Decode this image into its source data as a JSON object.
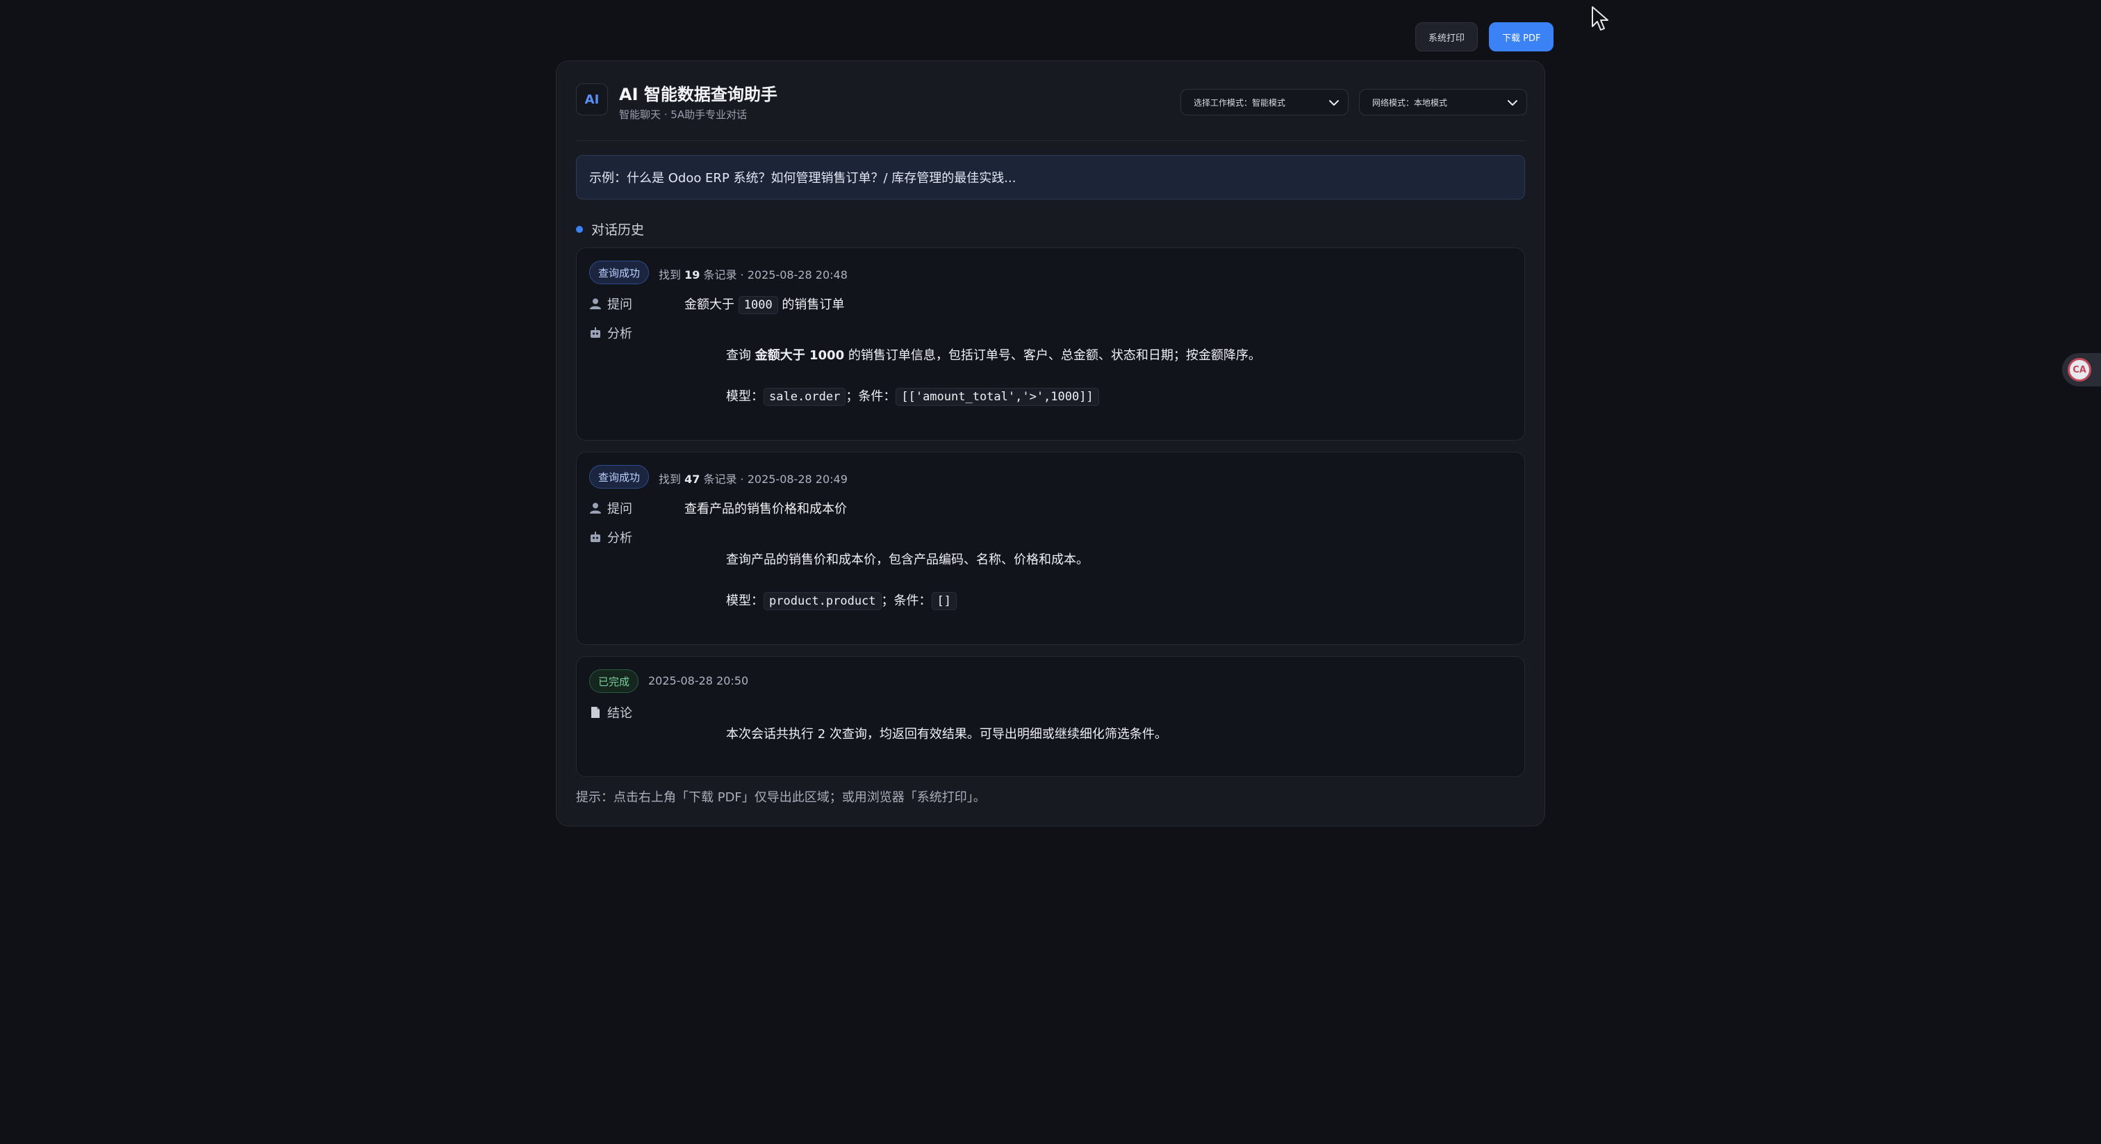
{
  "toolbar": {
    "print_label": "系统打印",
    "pdf_label": "下载 PDF"
  },
  "header": {
    "logo": "AI",
    "title": "AI 智能数据查询助手",
    "subtitle": "智能聊天 · 5A助手专业对话",
    "work_mode": "选择工作模式：智能模式",
    "network_mode": "网络模式：本地模式"
  },
  "example": "示例：什么是 Odoo ERP 系统？如何管理销售订单？/ 库存管理的最佳实践...",
  "history": {
    "title": "对话历史",
    "cards": [
      {
        "status": "查询成功",
        "meta_prefix": "找到 ",
        "count": "19",
        "meta_suffix": " 条记录 · 2025-08-28 20:48",
        "question_label": "提问",
        "question_pre": "金额大于 ",
        "question_code": "1000",
        "question_post": " 的销售订单",
        "analysis_label": "分析",
        "analysis_pre": "查询 ",
        "analysis_bold": "金额大于 1000",
        "analysis_post": " 的销售订单信息，包括订单号、客户、总金额、状态和日期；按金额降序。",
        "model_label": "模型：",
        "model_code": "sale.order",
        "cond_label": "；条件：",
        "cond_code": "[['amount_total','>',1000]]"
      },
      {
        "status": "查询成功",
        "meta_prefix": "找到 ",
        "count": "47",
        "meta_suffix": " 条记录 · 2025-08-28 20:49",
        "question_label": "提问",
        "question": "查看产品的销售价格和成本价",
        "analysis_label": "分析",
        "analysis": "查询产品的销售价和成本价，包含产品编码、名称、价格和成本。",
        "model_label": "模型：",
        "model_code": "product.product",
        "cond_label": "；条件：",
        "cond_code": "[]"
      },
      {
        "status": "已完成",
        "meta": "2025-08-28 20:50",
        "conclusion_label": "结论",
        "conclusion": "本次会话共执行 2 次查询，均返回有效结果。可导出明细或继续细化筛选条件。"
      }
    ]
  },
  "hint": "提示：点击右上角「下载 PDF」仅导出此区域；或用浏览器「系统打印」。",
  "side_badge": "CA",
  "colors": {
    "accent": "#3b82f6",
    "background": "#101117",
    "panel": "#181a22",
    "success": "#7ad09a"
  }
}
